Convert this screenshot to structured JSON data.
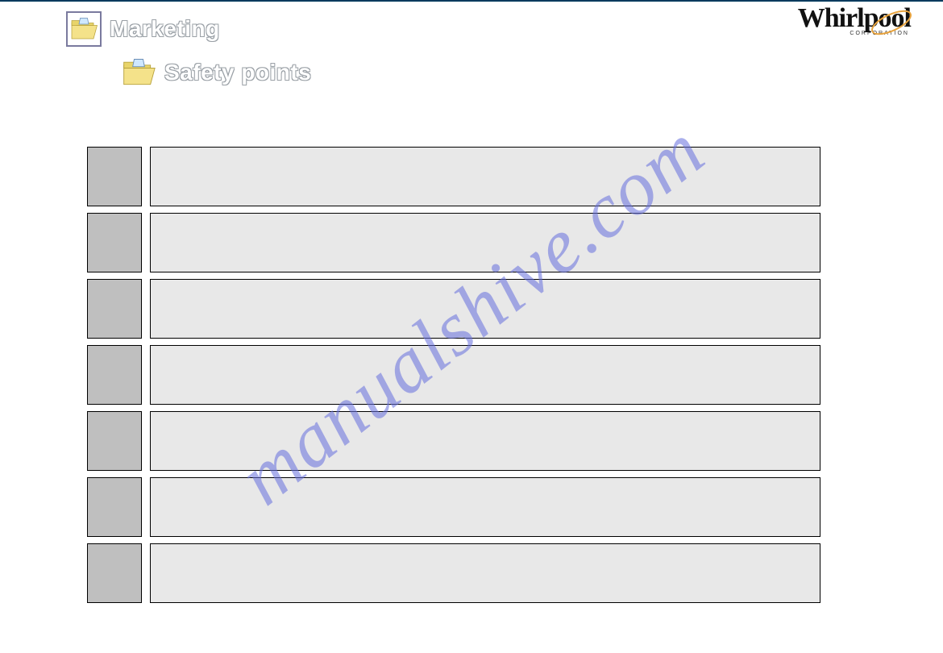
{
  "logo": {
    "brand": "Whirlpool",
    "sub": "CORPORATION"
  },
  "breadcrumb": {
    "level1": "Marketing",
    "level2": "Safety points"
  },
  "safety_points": [
    {
      "text": ""
    },
    {
      "text": ""
    },
    {
      "text": ""
    },
    {
      "text": ""
    },
    {
      "text": ""
    },
    {
      "text": ""
    },
    {
      "text": ""
    }
  ],
  "watermark": "manualshive.com"
}
